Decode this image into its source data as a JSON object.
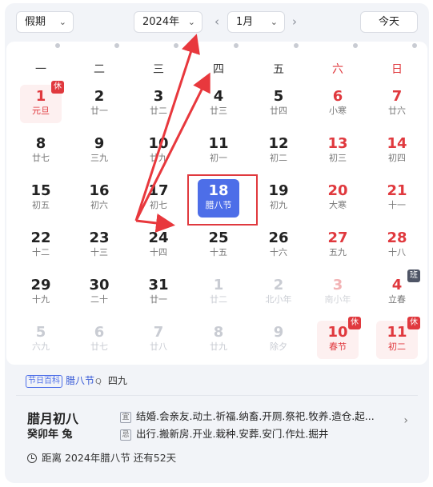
{
  "toolbar": {
    "holiday_select": "假期",
    "year_select": "2024年",
    "month_select": "1月",
    "prev_arrow": "‹",
    "next_arrow": "›",
    "today_button": "今天"
  },
  "weekdays": [
    "一",
    "二",
    "三",
    "四",
    "五",
    "六",
    "日"
  ],
  "weeks": [
    [
      {
        "d": "1",
        "l": "元旦",
        "holi": true,
        "badge": "休"
      },
      {
        "d": "2",
        "l": "廿一"
      },
      {
        "d": "3",
        "l": "廿二"
      },
      {
        "d": "4",
        "l": "廿三"
      },
      {
        "d": "5",
        "l": "廿四"
      },
      {
        "d": "6",
        "l": "小寒",
        "wend": true
      },
      {
        "d": "7",
        "l": "廿六",
        "wend": true
      }
    ],
    [
      {
        "d": "8",
        "l": "廿七"
      },
      {
        "d": "9",
        "l": "三九"
      },
      {
        "d": "10",
        "l": "廿九"
      },
      {
        "d": "11",
        "l": "初一"
      },
      {
        "d": "12",
        "l": "初二"
      },
      {
        "d": "13",
        "l": "初三",
        "wend": true
      },
      {
        "d": "14",
        "l": "初四",
        "wend": true
      }
    ],
    [
      {
        "d": "15",
        "l": "初五"
      },
      {
        "d": "16",
        "l": "初六"
      },
      {
        "d": "17",
        "l": "初七"
      },
      {
        "d": "18",
        "l": "腊八节",
        "selected": true
      },
      {
        "d": "19",
        "l": "初九"
      },
      {
        "d": "20",
        "l": "大寒",
        "wend": true
      },
      {
        "d": "21",
        "l": "十一",
        "wend": true
      }
    ],
    [
      {
        "d": "22",
        "l": "十二"
      },
      {
        "d": "23",
        "l": "十三"
      },
      {
        "d": "24",
        "l": "十四"
      },
      {
        "d": "25",
        "l": "十五"
      },
      {
        "d": "26",
        "l": "十六"
      },
      {
        "d": "27",
        "l": "五九",
        "wend": true
      },
      {
        "d": "28",
        "l": "十八",
        "wend": true
      }
    ],
    [
      {
        "d": "29",
        "l": "十九"
      },
      {
        "d": "30",
        "l": "二十"
      },
      {
        "d": "31",
        "l": "廿一"
      },
      {
        "d": "1",
        "l": "廿二",
        "dim": true
      },
      {
        "d": "2",
        "l": "北小年",
        "dim": true
      },
      {
        "d": "3",
        "l": "南小年",
        "dim": true,
        "wend": true
      },
      {
        "d": "4",
        "l": "立春",
        "badge": "班",
        "ban": true
      }
    ],
    [
      {
        "d": "5",
        "l": "六九",
        "dim": true
      },
      {
        "d": "6",
        "l": "廿七",
        "dim": true
      },
      {
        "d": "7",
        "l": "廿八",
        "dim": true
      },
      {
        "d": "8",
        "l": "廿九",
        "dim": true
      },
      {
        "d": "9",
        "l": "除夕",
        "dim": true
      },
      {
        "d": "10",
        "l": "春节",
        "holi": true,
        "badge": "休"
      },
      {
        "d": "11",
        "l": "初二",
        "holi": true,
        "badge": "休"
      }
    ]
  ],
  "info": {
    "tag_chip": "节日百科",
    "tag_link": "腊八节",
    "tag_search": "Q",
    "tag_plain": "四九",
    "lunar_date": "腊月初八",
    "lunar_year": "癸卯年 兔",
    "yi_mark": "宜",
    "yi_text": "结婚.会亲友.动土.祈福.纳畜.开厕.祭祀.牧养.造仓.起...",
    "ji_mark": "忌",
    "ji_text": "出行.搬新房.开业.栽种.安葬.安门.作灶.掘井",
    "countdown": "距离 2024年腊八节 还有52天"
  },
  "colors": {
    "accent": "#4d6ee8",
    "weekend_red": "#e0393e",
    "annotation_red": "#e8383d"
  }
}
